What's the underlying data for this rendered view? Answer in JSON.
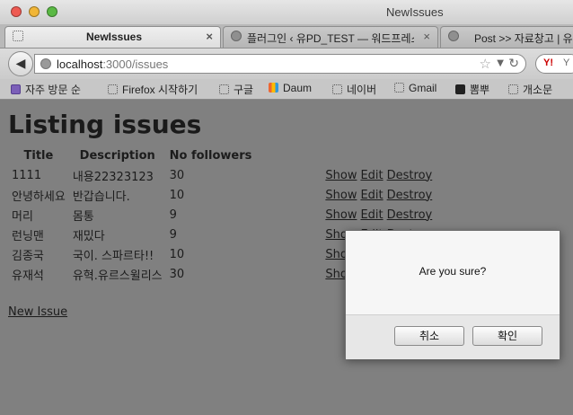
{
  "window": {
    "title": "NewIssues"
  },
  "tabs": [
    {
      "label": "NewIssues",
      "close": "×",
      "active": true
    },
    {
      "label": "플러그인 ‹ 유PD_TEST — 워드프레스",
      "close": "×"
    },
    {
      "label": "Post >> 자료창고 | 유"
    }
  ],
  "urlbar": {
    "host": "localhost",
    "rest": ":3000/issues"
  },
  "search": {
    "logo": "Y!",
    "text": "Y"
  },
  "bookmarks": [
    "자주 방문 순",
    "Firefox 시작하기",
    "구글",
    "Daum",
    "네이버",
    "Gmail",
    "뽐뿌",
    "개소문"
  ],
  "page": {
    "title": "Listing issues",
    "columns": [
      "Title",
      "Description",
      "No followers"
    ],
    "actions": [
      "Show",
      "Edit",
      "Destroy"
    ],
    "rows": [
      {
        "title": "1111",
        "description": "내용22323123",
        "followers": "30"
      },
      {
        "title": "안녕하세요",
        "description": "반갑습니다.",
        "followers": "10"
      },
      {
        "title": "머리",
        "description": "몸통",
        "followers": "9"
      },
      {
        "title": "런닝맨",
        "description": "재밌다",
        "followers": "9"
      },
      {
        "title": "김종국",
        "description": "국이. 스파르타!!",
        "followers": "10"
      },
      {
        "title": "유재석",
        "description": "유혁.유르스윌리스",
        "followers": "30"
      }
    ],
    "new_issue_link": "New Issue"
  },
  "dialog": {
    "message": "Are you sure?",
    "cancel": "취소",
    "ok": "확인"
  }
}
